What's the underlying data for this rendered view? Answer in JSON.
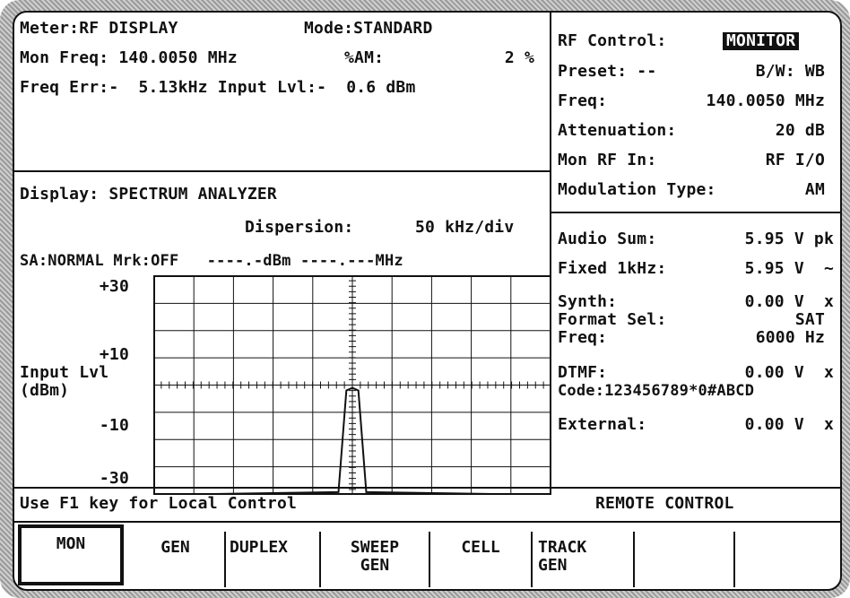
{
  "meter": {
    "meter_label": "Meter:RF DISPLAY",
    "mode_label": "Mode:STANDARD",
    "mon_freq": "Mon Freq: 140.0050 MHz",
    "am_label": "%AM:",
    "am_value": "2 %",
    "freq_err": "Freq Err:-  5.13kHz Input Lvl:-  0.6 dBm"
  },
  "display": {
    "title": "Display: SPECTRUM ANALYZER",
    "dispersion_label": "Dispersion:",
    "dispersion_value": "50 kHz/div",
    "sa_status": "SA:NORMAL Mrk:OFF   ----.-dBm ----.---MHz"
  },
  "chart_data": {
    "type": "line",
    "ylabel": "Input Lvl (dBm)",
    "y_tick_labels": [
      "+30",
      "+10",
      "-10",
      "-30"
    ],
    "ylim": [
      -40,
      40
    ],
    "x_divisions": 10,
    "y_divisions": 8,
    "grid": true,
    "series": [
      {
        "x": [
          -5,
          -0.35,
          -0.15,
          0,
          0.15,
          0.35,
          5
        ],
        "y": [
          -40,
          -39,
          -2,
          -1,
          -2,
          -39,
          -40
        ]
      }
    ]
  },
  "rf_control": {
    "label": "RF Control:",
    "value": "MONITOR",
    "preset": "Preset: --",
    "bw": "B/W: WB",
    "freq_label": "Freq:",
    "freq_value": "140.0050 MHz",
    "atten_label": "Attenuation:",
    "atten_value": "20 dB",
    "mon_rf_label": "Mon RF In:",
    "mon_rf_value": "RF I/O",
    "mod_label": "Modulation Type:",
    "mod_value": "AM"
  },
  "audio": {
    "sum_label": "Audio Sum:",
    "sum_value": "5.95 V pk",
    "fixed_label": "Fixed 1kHz:",
    "fixed_value": "5.95 V  ~",
    "synth_label": "Synth:",
    "synth_value": "0.00 V  x",
    "format_label": "Format Sel:",
    "format_value": "SAT",
    "fmt_freq_label": "Freq:",
    "fmt_freq_value": "6000 Hz",
    "dtmf_label": "DTMF:",
    "dtmf_value": "0.00 V  x",
    "code": "Code:123456789*0#ABCD",
    "ext_label": "External:",
    "ext_value": "0.00 V  x"
  },
  "status": {
    "local": "Use F1 key for Local Control",
    "remote": "REMOTE CONTROL"
  },
  "softkeys": [
    {
      "line1": "MON",
      "line2": ""
    },
    {
      "line1": "GEN",
      "line2": ""
    },
    {
      "line1": "DUPLEX",
      "line2": ""
    },
    {
      "line1": "SWEEP",
      "line2": "GEN"
    },
    {
      "line1": "CELL",
      "line2": ""
    },
    {
      "line1": "TRACK",
      "line2": "GEN"
    },
    {
      "line1": "",
      "line2": ""
    },
    {
      "line1": "",
      "line2": ""
    }
  ]
}
